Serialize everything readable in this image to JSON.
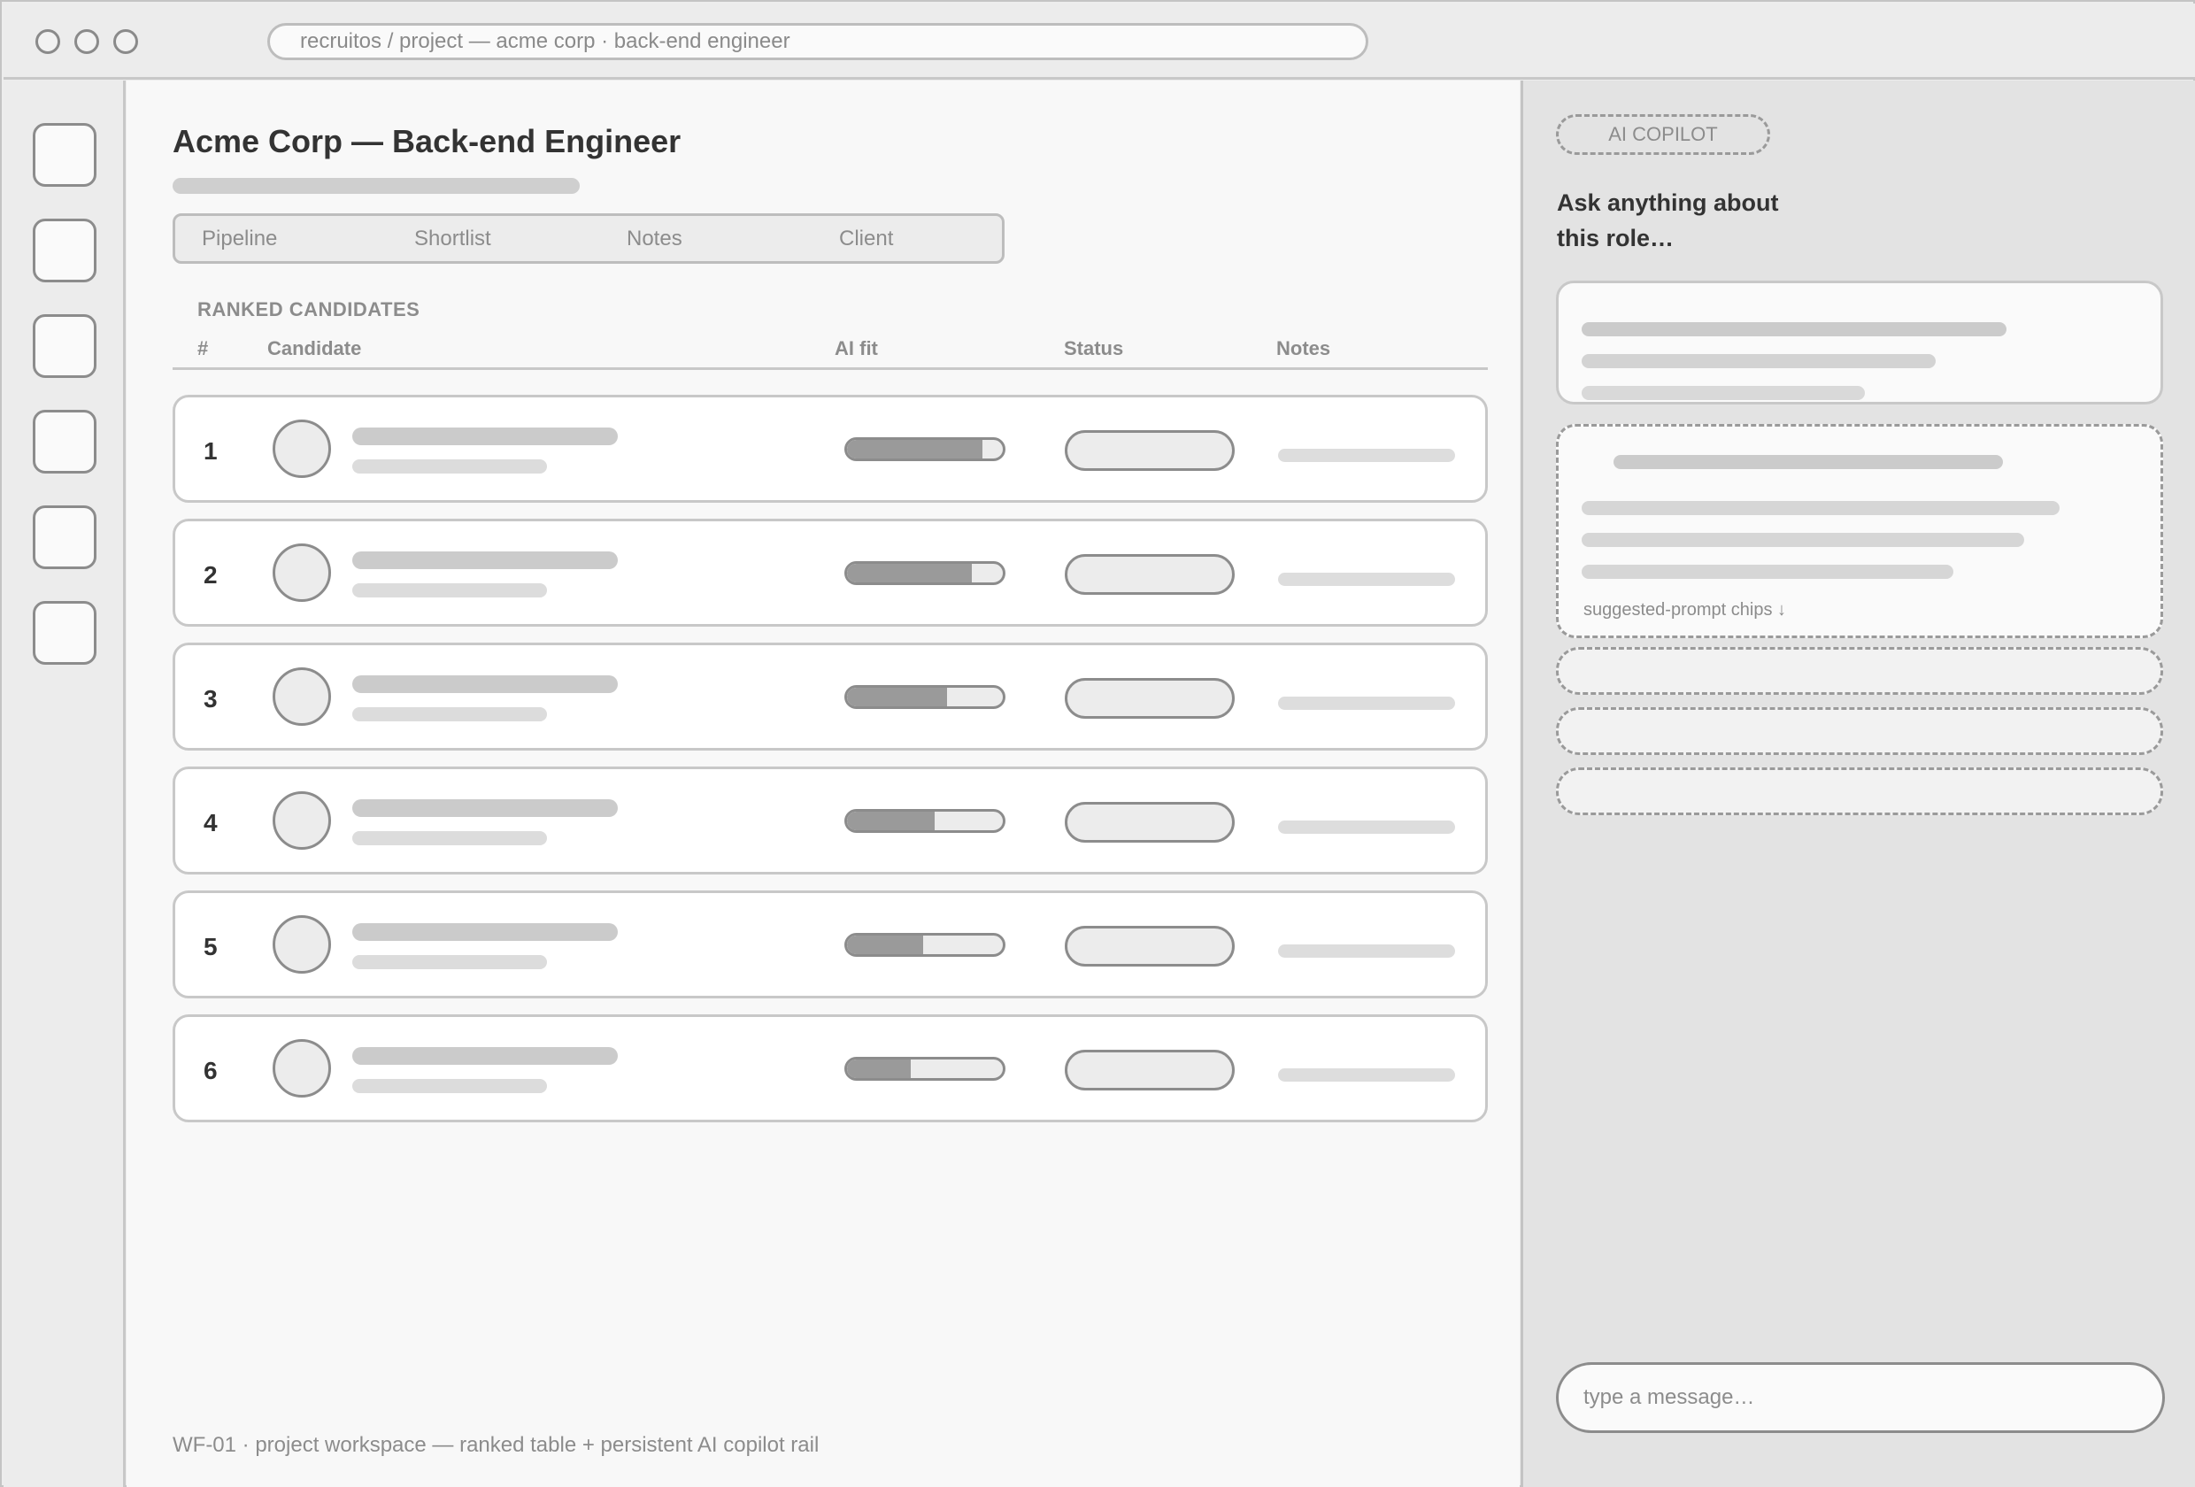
{
  "browser": {
    "url": "recruitos / project — acme corp · back-end engineer"
  },
  "main": {
    "title": "Acme Corp — Back-end Engineer",
    "tabs": [
      {
        "label": "Pipeline"
      },
      {
        "label": "Shortlist"
      },
      {
        "label": "Notes"
      },
      {
        "label": "Client"
      }
    ],
    "section_label": "RANKED CANDIDATES",
    "columns": {
      "rank": "#",
      "candidate": "Candidate",
      "ai_fit": "AI fit",
      "status": "Status",
      "notes": "Notes"
    },
    "rows": [
      {
        "rank": "1",
        "ai_fit": 0.87
      },
      {
        "rank": "2",
        "ai_fit": 0.8
      },
      {
        "rank": "3",
        "ai_fit": 0.64
      },
      {
        "rank": "4",
        "ai_fit": 0.56
      },
      {
        "rank": "5",
        "ai_fit": 0.49
      },
      {
        "rank": "6",
        "ai_fit": 0.41
      }
    ],
    "footnote": "WF-01 · project workspace — ranked table + persistent AI copilot rail"
  },
  "copilot": {
    "badge": "AI COPILOT",
    "prompt": "Ask anything about this role…",
    "chips_note": "suggested-prompt chips ↓",
    "input_placeholder": "type a message…"
  }
}
